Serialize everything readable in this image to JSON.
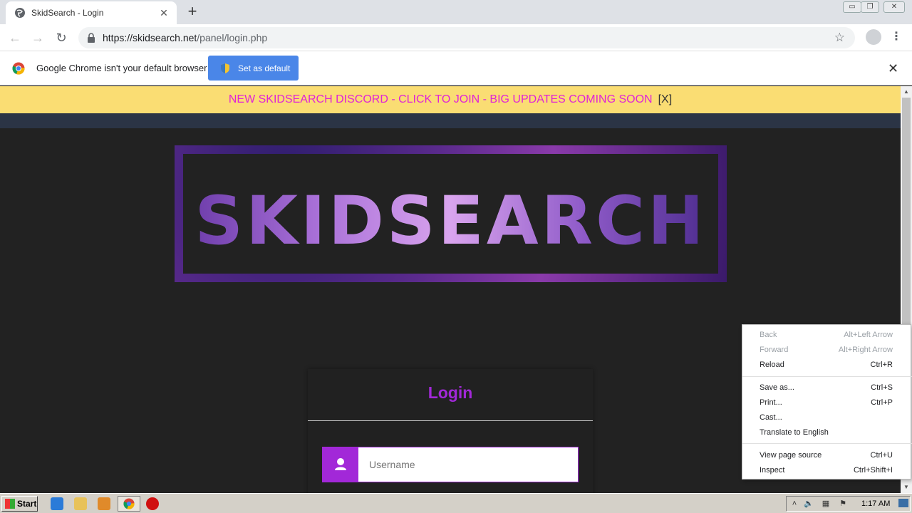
{
  "tab": {
    "title": "SkidSearch - Login",
    "close_glyph": "✕",
    "new_tab_glyph": "+"
  },
  "window_controls": {
    "minimize": "▭",
    "maximize": "❐",
    "close": "✕"
  },
  "toolbar": {
    "back_glyph": "←",
    "forward_glyph": "→",
    "reload_glyph": "↻",
    "url_base": "https://skidsearch.net",
    "url_path": "/panel/login.php",
    "star_glyph": "☆",
    "menu_glyph": "⋮"
  },
  "infobar": {
    "message": "Google Chrome isn't your default browser",
    "button": "Set as default",
    "close_glyph": "✕"
  },
  "page": {
    "announcement": "NEW SKIDSEARCH DISCORD - CLICK TO JOIN - BIG UPDATES COMING SOON",
    "announcement_close": "[X]",
    "logo_text": "SKIDSEARCH",
    "login_title": "Login",
    "username_placeholder": "Username"
  },
  "context_menu": {
    "group1": [
      {
        "label": "Back",
        "shortcut": "Alt+Left Arrow",
        "disabled": true
      },
      {
        "label": "Forward",
        "shortcut": "Alt+Right Arrow",
        "disabled": true
      },
      {
        "label": "Reload",
        "shortcut": "Ctrl+R",
        "disabled": false
      }
    ],
    "group2": [
      {
        "label": "Save as...",
        "shortcut": "Ctrl+S"
      },
      {
        "label": "Print...",
        "shortcut": "Ctrl+P"
      },
      {
        "label": "Cast...",
        "shortcut": ""
      },
      {
        "label": "Translate to English",
        "shortcut": ""
      }
    ],
    "group3": [
      {
        "label": "View page source",
        "shortcut": "Ctrl+U"
      },
      {
        "label": "Inspect",
        "shortcut": "Ctrl+Shift+I"
      }
    ]
  },
  "taskbar": {
    "start_label": "Start",
    "clock": "1:17 AM"
  },
  "colors": {
    "accent_purple": "#a228d8",
    "announce_bg": "#fadd73",
    "announce_text": "#e022d8",
    "chrome_blue": "#4a86e8"
  }
}
